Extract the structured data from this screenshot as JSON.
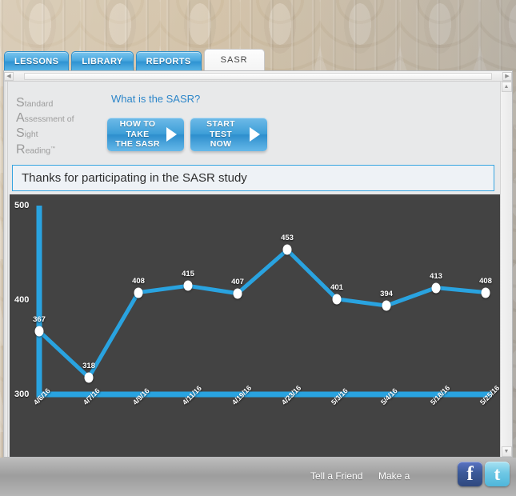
{
  "tabs": [
    {
      "label": "LESSONS",
      "active": false
    },
    {
      "label": "LIBRARY",
      "active": false
    },
    {
      "label": "REPORTS",
      "active": false
    },
    {
      "label": "SASR",
      "active": true
    }
  ],
  "logo": {
    "line1_cap": "S",
    "line1_rest": "tandard",
    "line2_cap": "A",
    "line2_rest": "ssessment of",
    "line3_cap": "S",
    "line3_rest": "ight",
    "line4_cap": "R",
    "line4_rest": "eading",
    "tm": "™"
  },
  "header": {
    "what_is_link": "What is the SASR?",
    "how_to_take_line1": "HOW TO TAKE",
    "how_to_take_line2": "THE SASR",
    "start_test_line1": "START TEST",
    "start_test_line2": "NOW"
  },
  "banner": {
    "message": "Thanks for participating in the SASR study"
  },
  "footer": {
    "tell_a_friend": "Tell a Friend",
    "make_a": "Make a",
    "facebook_glyph": "f",
    "twitter_glyph": "t"
  },
  "scrollbars": {
    "left_arrow": "◀",
    "right_arrow": "▶",
    "up_arrow": "▲",
    "down_arrow": "▼"
  },
  "colors": {
    "accent_blue": "#29a3e0",
    "tab_blue": "#3e9fd8",
    "chart_bg": "#434343",
    "point_fill": "#ffffff",
    "banner_border": "#35a4e0"
  },
  "chart_data": {
    "type": "line",
    "title": "",
    "xlabel": "",
    "ylabel": "",
    "ylim": [
      300,
      500
    ],
    "yticks": [
      300,
      400,
      500
    ],
    "grid": false,
    "legend": null,
    "categories": [
      "4/6/16",
      "4/7/16",
      "4/9/16",
      "4/11/16",
      "4/19/16",
      "4/23/16",
      "5/3/16",
      "5/4/16",
      "5/18/16",
      "5/25/16"
    ],
    "values": [
      367,
      318,
      408,
      415,
      407,
      453,
      401,
      394,
      413,
      408
    ],
    "point_labels": [
      "367",
      "318",
      "408",
      "415",
      "407",
      "453",
      "401",
      "394",
      "413",
      "408"
    ],
    "line_color": "#29a3e0",
    "marker_color": "#ffffff",
    "background": "#434343"
  }
}
